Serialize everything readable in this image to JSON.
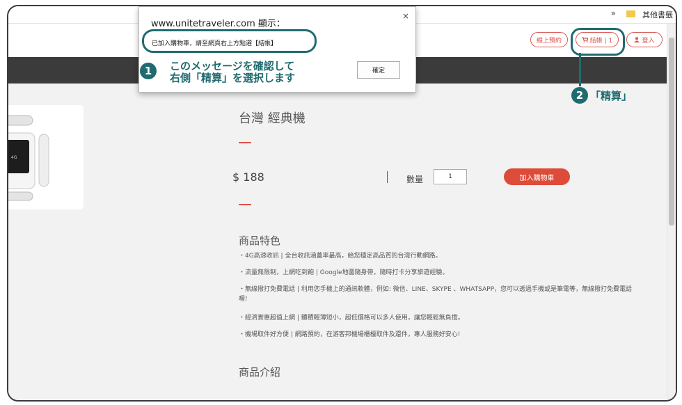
{
  "browser": {
    "bookmarks_chevron": "»",
    "bookmarks_other": "其他書籤"
  },
  "header": {
    "online_booking": "線上預約",
    "checkout": "結帳 | 1",
    "login": "登入"
  },
  "dialog": {
    "title": "www.unitetraveler.com 顯示：",
    "message": "已加入購物車，請至網頁右上方點選【結帳】",
    "ok": "確定",
    "close": "×"
  },
  "product": {
    "title": "台灣 經典機",
    "price": "$ 188",
    "qty_label": "數量",
    "qty_value": "1",
    "add_to_cart": "加入購物車",
    "device_label": "4G"
  },
  "features": {
    "heading": "商品特色",
    "items": [
      "・4G高速收訊 | 全台收訊涵蓋率最高，給您穩定高品質的台灣行動網路。",
      "・流量無限制，上網吃到飽 | Google地圖隨身帶，隨時打卡分享旅遊經驗。",
      "・無線撥打免費電話 | 利用您手機上的通訊軟體，例如: 微信、LINE、SKYPE 、WHATSAPP，您可以透過手機或是筆電等，無線撥打免費電話喔!",
      "・經濟實惠超值上網 | 體積輕薄短小，超低價格可以多人使用，讓您輕鬆無負擔。",
      "・機場取件好方便 | 網路預約，在游客邦機場櫃檯取件及還件，專人服務好安心!"
    ]
  },
  "intro": {
    "heading": "商品介紹"
  },
  "annotations": {
    "step1_number": "1",
    "step1_line1": "このメッセージを確認して",
    "step1_line2": "右側「精算」を選択します",
    "step2_number": "2",
    "step2_text": "「精算」",
    "color": "#1f6b70"
  }
}
